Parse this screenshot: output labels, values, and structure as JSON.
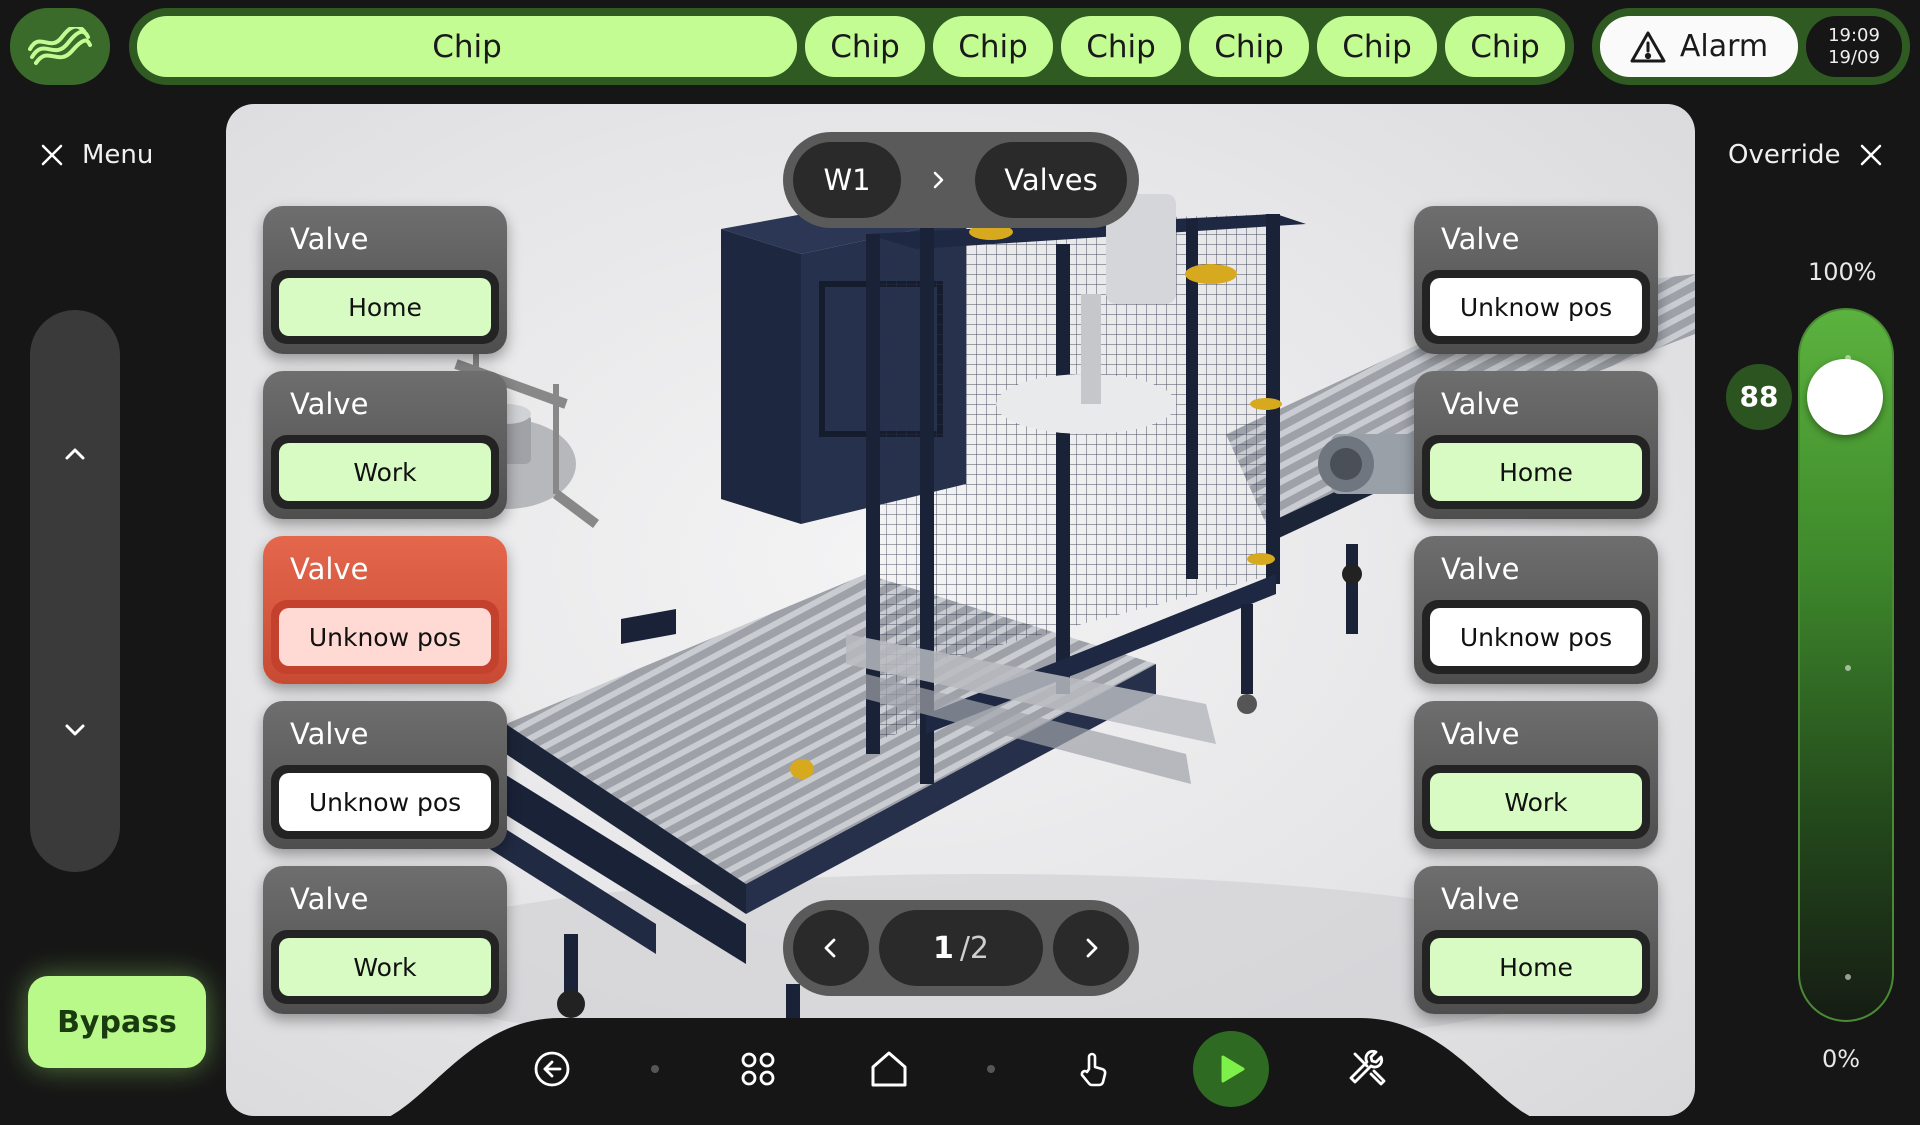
{
  "chips": [
    "Chip",
    "Chip",
    "Chip",
    "Chip",
    "Chip",
    "Chip",
    "Chip"
  ],
  "alarm": {
    "label": "Alarm"
  },
  "clock": {
    "time": "19:09",
    "date": "19/09"
  },
  "menu": {
    "label": "Menu"
  },
  "override": {
    "label": "Override",
    "max_label": "100%",
    "min_label": "0%",
    "value": 88
  },
  "bypass": {
    "label": "Bypass"
  },
  "breadcrumb": {
    "station": "W1",
    "section": "Valves"
  },
  "valves_left": [
    {
      "title": "Valve",
      "status": "Home",
      "state": "ok"
    },
    {
      "title": "Valve",
      "status": "Work",
      "state": "ok"
    },
    {
      "title": "Valve",
      "status": "Unknow pos",
      "state": "error"
    },
    {
      "title": "Valve",
      "status": "Unknow pos",
      "state": "unknown"
    },
    {
      "title": "Valve",
      "status": "Work",
      "state": "ok"
    }
  ],
  "valves_right": [
    {
      "title": "Valve",
      "status": "Unknow pos",
      "state": "unknown"
    },
    {
      "title": "Valve",
      "status": "Home",
      "state": "ok"
    },
    {
      "title": "Valve",
      "status": "Unknow pos",
      "state": "unknown"
    },
    {
      "title": "Valve",
      "status": "Work",
      "state": "ok"
    },
    {
      "title": "Valve",
      "status": "Home",
      "state": "ok"
    }
  ],
  "pager": {
    "current": "1",
    "total": "/2"
  },
  "nav_icons": [
    "back-icon",
    "apps-grid-icon",
    "home-icon",
    "hand-icon",
    "play-icon",
    "tools-icon"
  ],
  "colors": {
    "accent": "#c4fc94",
    "accent_dark": "#2f5a22",
    "error": "#d4553d"
  }
}
